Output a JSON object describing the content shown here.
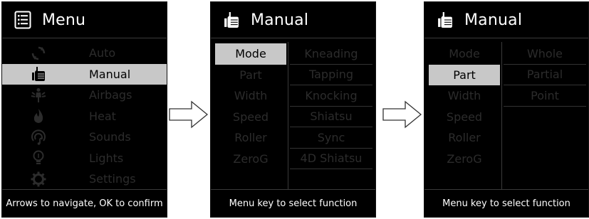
{
  "menu_screen": {
    "title": "Menu",
    "header_icon": "list-icon",
    "items": [
      {
        "label": "Auto",
        "icon": "refresh-icon",
        "selected": false
      },
      {
        "label": "Manual",
        "icon": "thumbs-up-icon",
        "selected": true
      },
      {
        "label": "Airbags",
        "icon": "airbag-person-icon",
        "selected": false
      },
      {
        "label": "Heat",
        "icon": "flame-icon",
        "selected": false
      },
      {
        "label": "Sounds",
        "icon": "sound-icon",
        "selected": false
      },
      {
        "label": "Lights",
        "icon": "lightbulb-icon",
        "selected": false
      },
      {
        "label": "Settings",
        "icon": "gear-icon",
        "selected": false
      }
    ],
    "footer": "Arrows to navigate, OK to confirm"
  },
  "manual_mode_screen": {
    "title": "Manual",
    "header_icon": "thumbs-up-icon",
    "left_options": [
      "Mode",
      "Part",
      "Width",
      "Speed",
      "Roller",
      "ZeroG"
    ],
    "left_selected": "Mode",
    "right_options": [
      "Kneading",
      "Tapping",
      "Knocking",
      "Shiatsu",
      "Sync",
      "4D Shiatsu"
    ],
    "footer": "Menu key to select function"
  },
  "manual_part_screen": {
    "title": "Manual",
    "header_icon": "thumbs-up-icon",
    "left_options": [
      "Mode",
      "Part",
      "Width",
      "Speed",
      "Roller",
      "ZeroG"
    ],
    "left_selected": "Part",
    "right_options": [
      "Whole",
      "Partial",
      "Point"
    ],
    "footer": "Menu key to select function"
  },
  "colors": {
    "screen_bg": "#000000",
    "text_active": "#ffffff",
    "text_dim": "#2c2c2c",
    "highlight": "#c8c8c8",
    "divider": "#3a3a3a"
  }
}
